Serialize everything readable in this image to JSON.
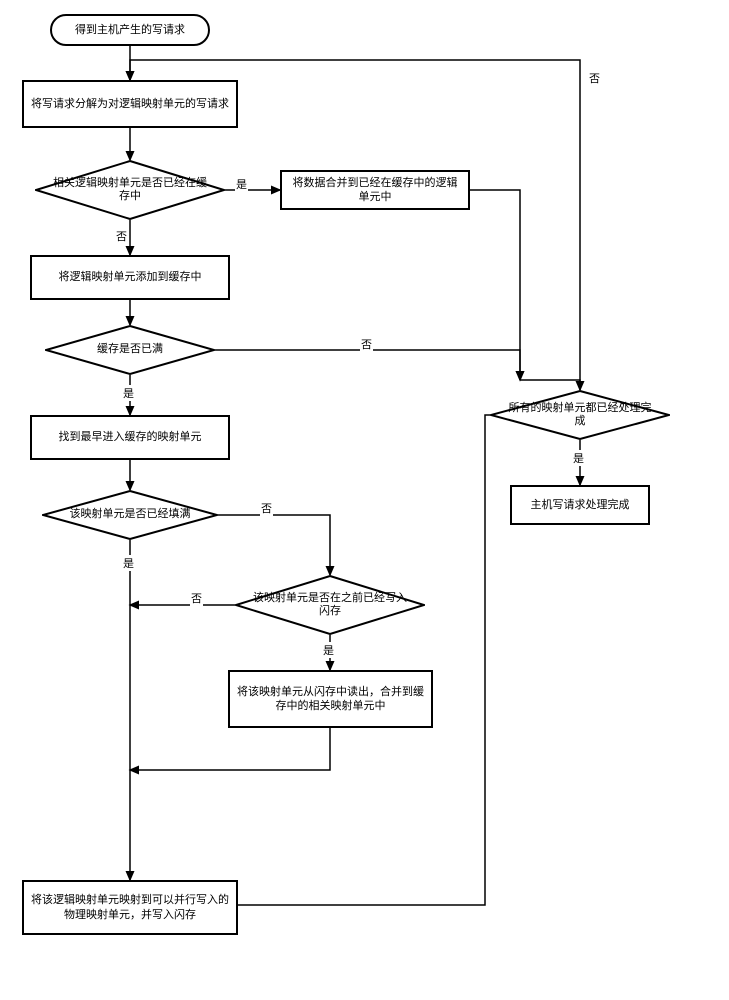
{
  "nodes": {
    "start": "得到主机产生的写请求",
    "split": "将写请求分解为对逻辑映射单元的写请求",
    "d_in_cache": "相关逻辑映射单元是否已经在缓存中",
    "merge_cache": "将数据合并到已经在缓存中的逻辑单元中",
    "add_cache": "将逻辑映射单元添加到缓存中",
    "d_cache_full": "缓存是否已满",
    "find_oldest": "找到最早进入缓存的映射单元",
    "d_unit_full": "该映射单元是否已经填满",
    "d_written_before": "该映射单元是否在之前已经写入闪存",
    "read_merge": "将该映射单元从闪存中读出，合并到缓存中的相关映射单元中",
    "map_write": "将该逻辑映射单元映射到可以并行写入的物理映射单元，并写入闪存",
    "d_all_done": "所有的映射单元都已经处理完成",
    "done": "主机写请求处理完成"
  },
  "labels": {
    "yes": "是",
    "no": "否"
  }
}
